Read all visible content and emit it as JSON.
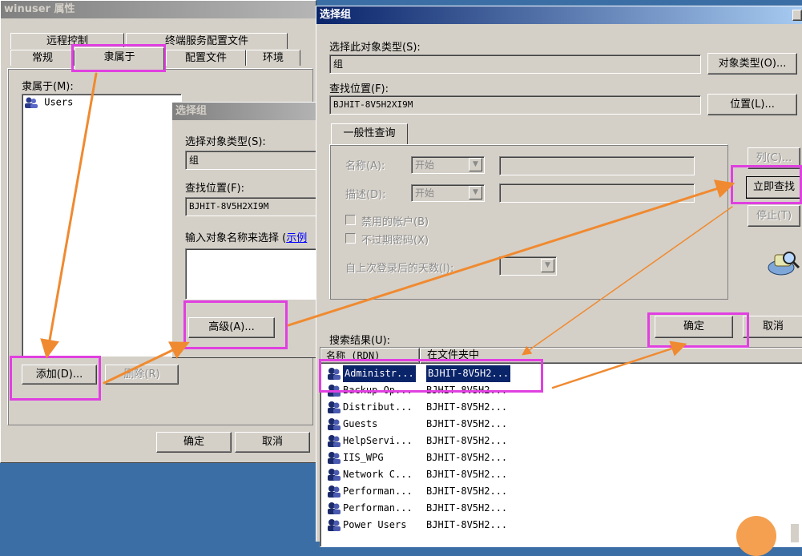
{
  "props": {
    "title": "winuser 属性",
    "tabs_row1": [
      "远程控制",
      "终端服务配置文件"
    ],
    "tabs_row2": [
      "常规",
      "隶属于",
      "配置文件",
      "环境"
    ],
    "memberof_label": "隶属于(M):",
    "members": [
      "Users"
    ],
    "add_button": "添加(D)...",
    "remove_button": "删除(R)",
    "ok_button": "确定",
    "cancel_button": "取消"
  },
  "small_dialog": {
    "title": "选择组",
    "type_label": "选择对象类型(S):",
    "type_value": "组",
    "location_label": "查找位置(F):",
    "location_value": "BJHIT-8V5H2XI9M",
    "enter_label": "输入对象名称来选择",
    "enter_link": "示例",
    "advanced_button": "高级(A)..."
  },
  "big_dialog": {
    "title": "选择组",
    "type_label": "选择此对象类型(S):",
    "type_value": "组",
    "type_button": "对象类型(O)...",
    "location_label": "查找位置(F):",
    "location_value": "BJHIT-8V5H2XI9M",
    "location_button": "位置(L)...",
    "tab_label": "一般性查询",
    "name_label": "名称(A):",
    "name_mode": "开始",
    "desc_label": "描述(D):",
    "desc_mode": "开始",
    "disabled_accounts": "禁用的帐户(B)",
    "non_expiring": "不过期密码(X)",
    "days_since_logon": "自上次登录后的天数(I):",
    "columns_button": "列(C)...",
    "find_now_button": "立即查找",
    "stop_button": "停止(T)",
    "ok_button": "确定",
    "cancel_button": "取消",
    "results_label": "搜索结果(U):",
    "col_name": "名称 (RDN)",
    "col_folder": "在文件夹中",
    "results": [
      {
        "name": "Administr...",
        "folder": "BJHIT-8V5H2..."
      },
      {
        "name": "Backup Op...",
        "folder": "BJHIT-8V5H2..."
      },
      {
        "name": "Distribut...",
        "folder": "BJHIT-8V5H2..."
      },
      {
        "name": "Guests",
        "folder": "BJHIT-8V5H2..."
      },
      {
        "name": "HelpServi...",
        "folder": "BJHIT-8V5H2..."
      },
      {
        "name": "IIS_WPG",
        "folder": "BJHIT-8V5H2..."
      },
      {
        "name": "Network C...",
        "folder": "BJHIT-8V5H2..."
      },
      {
        "name": "Performan...",
        "folder": "BJHIT-8V5H2..."
      },
      {
        "name": "Performan...",
        "folder": "BJHIT-8V5H2..."
      },
      {
        "name": "Power Users",
        "folder": "BJHIT-8V5H2..."
      }
    ]
  },
  "colors": {
    "highlight": "#e040e0",
    "arrow": "#f08a30",
    "selection": "#0a246a"
  }
}
